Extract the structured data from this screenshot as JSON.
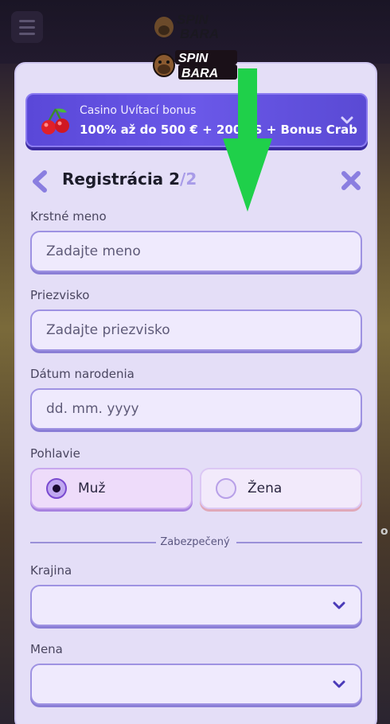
{
  "brand": {
    "name_line1": "SPIN",
    "name_line2": "BARA"
  },
  "bonus": {
    "title": "Casino Uvítací bonus",
    "subtitle": "100% až do 500 € + 200 FS + Bonus Crab"
  },
  "header": {
    "title": "Registrácia 2",
    "step_total": "/2"
  },
  "form": {
    "first_name": {
      "label": "Krstné meno",
      "placeholder": "Zadajte meno",
      "value": ""
    },
    "last_name": {
      "label": "Priezvisko",
      "placeholder": "Zadajte priezvisko",
      "value": ""
    },
    "birth_date": {
      "label": "Dátum narodenia",
      "placeholder": "dd. mm. yyyy",
      "value": ""
    },
    "gender": {
      "label": "Pohlavie",
      "options": [
        "Muž",
        "Žena"
      ],
      "selected": "Muž"
    },
    "secure_label": "Zabezpečený",
    "country": {
      "label": "Krajina",
      "value": ""
    },
    "currency": {
      "label": "Mena",
      "value": ""
    }
  },
  "edge_text": "o",
  "colors": {
    "accent": "#6a58e8",
    "card_bg": "#e4def7",
    "field_border": "#9e92e2",
    "arrow": "#1fd04a"
  },
  "icons": [
    "menu-icon",
    "cherry-icon",
    "chevron-down-icon",
    "arrow-down-indicator",
    "back-chevron-icon",
    "close-icon"
  ]
}
